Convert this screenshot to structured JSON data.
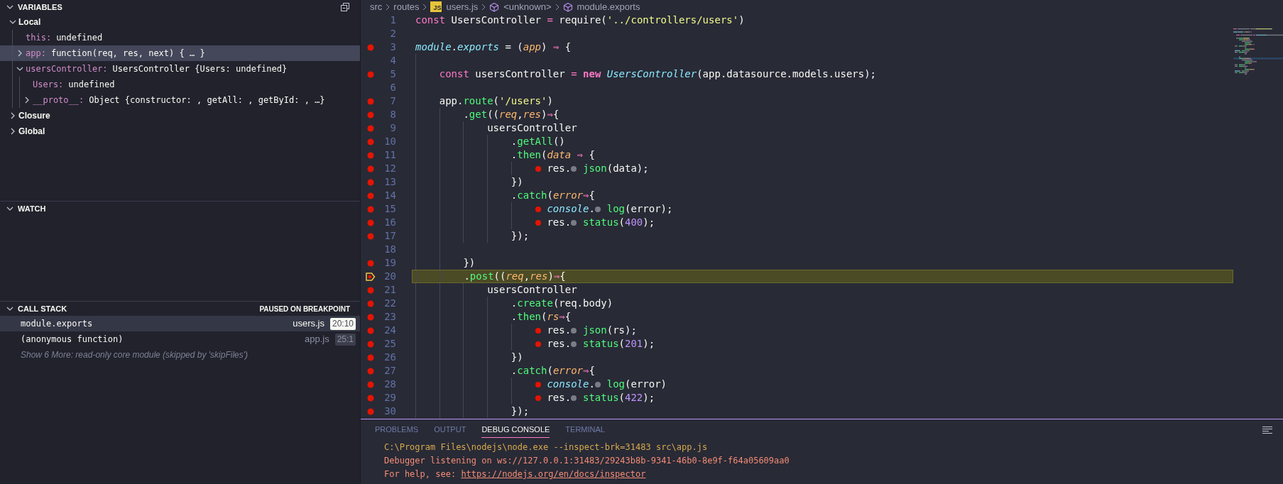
{
  "variables": {
    "title": "VARIABLES",
    "expanded": true,
    "items": [
      {
        "kind": "scope",
        "label": "Local",
        "expanded": true,
        "selected": false,
        "children": [
          {
            "kind": "variable",
            "name": "this:",
            "value": "undefined",
            "selected": false
          },
          {
            "kind": "variable",
            "name": "app:",
            "value": "function(req, res, next) { … }",
            "expanded": false,
            "selected": true
          },
          {
            "kind": "variable",
            "name": "usersController:",
            "value": "UsersController {Users: undefined}",
            "expanded": true,
            "selected": false,
            "children": [
              {
                "kind": "variable",
                "name": "Users:",
                "value": "undefined",
                "selected": false
              },
              {
                "kind": "variable",
                "name": "__proto__:",
                "value": "Object {constructor: , getAll: , getById: , …}",
                "expanded": false,
                "selected": false
              }
            ]
          }
        ]
      },
      {
        "kind": "scope",
        "label": "Closure",
        "expanded": false,
        "selected": false
      },
      {
        "kind": "scope",
        "label": "Global",
        "expanded": false,
        "selected": false
      }
    ]
  },
  "watch": {
    "title": "WATCH",
    "expanded": true
  },
  "call_stack": {
    "title": "CALL STACK",
    "expanded": true,
    "status": "PAUSED ON BREAKPOINT",
    "frames": [
      {
        "name": "module.exports",
        "file": "users.js",
        "position": "20:10",
        "selected": true
      },
      {
        "name": "(anonymous function)",
        "file": "app.js",
        "position": "25:1",
        "selected": false
      }
    ],
    "note": "Show 6 More: read-only core module (skipped by 'skipFiles')"
  },
  "breadcrumb": [
    {
      "kind": "folder",
      "label": "src"
    },
    {
      "kind": "folder",
      "label": "routes"
    },
    {
      "kind": "file",
      "label": "users.js",
      "icon_label": "JS"
    },
    {
      "kind": "symbol",
      "label": "<unknown>"
    },
    {
      "kind": "symbol",
      "label": "module.exports"
    }
  ],
  "lines": [
    {
      "number": "1",
      "breakpoint": false,
      "current": false,
      "tokens": [
        {
          "kind": "keyword",
          "text": "const"
        },
        {
          "kind": "plain",
          "text": " UsersController "
        },
        {
          "kind": "operator",
          "text": "="
        },
        {
          "kind": "plain",
          "text": " require("
        },
        {
          "kind": "string",
          "text": "'../controllers/users'"
        },
        {
          "kind": "plain",
          "text": ")"
        }
      ]
    },
    {
      "number": "2",
      "breakpoint": false,
      "current": false
    },
    {
      "number": "3",
      "breakpoint": true,
      "current": false,
      "tokens": [
        {
          "kind": "class",
          "text": "module"
        },
        {
          "kind": "plain",
          "text": "."
        },
        {
          "kind": "class",
          "text": "exports"
        },
        {
          "kind": "plain",
          "text": " = ("
        },
        {
          "kind": "param",
          "text": "app"
        },
        {
          "kind": "plain",
          "text": ") "
        },
        {
          "kind": "operator",
          "text": "⇒"
        },
        {
          "kind": "plain",
          "text": " {"
        }
      ]
    },
    {
      "number": "4",
      "breakpoint": false,
      "current": false
    },
    {
      "number": "5",
      "breakpoint": true,
      "current": false,
      "tokens": [
        {
          "kind": "keyword",
          "text": "    const"
        },
        {
          "kind": "plain",
          "text": " usersController "
        },
        {
          "kind": "operator",
          "text": "="
        },
        {
          "kind": "keyword_strong",
          "text": " new"
        },
        {
          "kind": "class",
          "text": " UsersController"
        },
        {
          "kind": "plain",
          "text": "(app.datasource.models.users);"
        }
      ]
    },
    {
      "number": "6",
      "breakpoint": false,
      "current": false
    },
    {
      "number": "7",
      "breakpoint": true,
      "current": false,
      "tokens": [
        {
          "kind": "plain",
          "text": "    app."
        },
        {
          "kind": "function",
          "text": "route"
        },
        {
          "kind": "plain",
          "text": "("
        },
        {
          "kind": "string",
          "text": "'/users'"
        },
        {
          "kind": "plain",
          "text": ")"
        }
      ]
    },
    {
      "number": "8",
      "breakpoint": true,
      "current": false,
      "tokens": [
        {
          "kind": "plain",
          "text": "        ."
        },
        {
          "kind": "function",
          "text": "get"
        },
        {
          "kind": "plain",
          "text": "(("
        },
        {
          "kind": "param",
          "text": "req"
        },
        {
          "kind": "plain",
          "text": ","
        },
        {
          "kind": "param",
          "text": "res"
        },
        {
          "kind": "plain",
          "text": ")"
        },
        {
          "kind": "operator",
          "text": "⇒"
        },
        {
          "kind": "plain",
          "text": "{"
        }
      ]
    },
    {
      "number": "9",
      "breakpoint": true,
      "current": false,
      "tokens": [
        {
          "kind": "plain",
          "text": "            usersController"
        }
      ]
    },
    {
      "number": "10",
      "breakpoint": true,
      "current": false,
      "tokens": [
        {
          "kind": "plain",
          "text": "                ."
        },
        {
          "kind": "function",
          "text": "getAll"
        },
        {
          "kind": "plain",
          "text": "()"
        }
      ]
    },
    {
      "number": "11",
      "breakpoint": true,
      "current": false,
      "tokens": [
        {
          "kind": "plain",
          "text": "                ."
        },
        {
          "kind": "function",
          "text": "then"
        },
        {
          "kind": "plain",
          "text": "("
        },
        {
          "kind": "param",
          "text": "data"
        },
        {
          "kind": "operator",
          "text": " ⇒"
        },
        {
          "kind": "plain",
          "text": " {"
        }
      ]
    },
    {
      "number": "12",
      "breakpoint": true,
      "current": false,
      "tokens": [
        {
          "kind": "inline_breakpoint"
        },
        {
          "kind": "plain",
          "text": " res."
        },
        {
          "kind": "breakpoint_hint"
        },
        {
          "kind": "function",
          "text": " json"
        },
        {
          "kind": "plain",
          "text": "(data);"
        }
      ]
    },
    {
      "number": "13",
      "breakpoint": true,
      "current": false,
      "tokens": [
        {
          "kind": "plain",
          "text": "                })"
        }
      ]
    },
    {
      "number": "14",
      "breakpoint": true,
      "current": false,
      "tokens": [
        {
          "kind": "plain",
          "text": "                ."
        },
        {
          "kind": "function",
          "text": "catch"
        },
        {
          "kind": "plain",
          "text": "("
        },
        {
          "kind": "param",
          "text": "error"
        },
        {
          "kind": "operator",
          "text": "⇒"
        },
        {
          "kind": "plain",
          "text": "{"
        }
      ]
    },
    {
      "number": "15",
      "breakpoint": true,
      "current": false,
      "tokens": [
        {
          "kind": "inline_breakpoint"
        },
        {
          "kind": "class",
          "text": " console"
        },
        {
          "kind": "plain",
          "text": "."
        },
        {
          "kind": "breakpoint_hint"
        },
        {
          "kind": "function",
          "text": " log"
        },
        {
          "kind": "plain",
          "text": "(error);"
        }
      ]
    },
    {
      "number": "16",
      "breakpoint": true,
      "current": false,
      "tokens": [
        {
          "kind": "inline_breakpoint"
        },
        {
          "kind": "plain",
          "text": " res."
        },
        {
          "kind": "breakpoint_hint"
        },
        {
          "kind": "function",
          "text": " status"
        },
        {
          "kind": "plain",
          "text": "("
        },
        {
          "kind": "number",
          "text": "400"
        },
        {
          "kind": "plain",
          "text": ");"
        }
      ]
    },
    {
      "number": "17",
      "breakpoint": true,
      "current": false,
      "tokens": [
        {
          "kind": "plain",
          "text": "                });"
        }
      ]
    },
    {
      "number": "18",
      "breakpoint": false,
      "current": false
    },
    {
      "number": "19",
      "breakpoint": true,
      "current": false,
      "tokens": [
        {
          "kind": "plain",
          "text": "        })"
        }
      ]
    },
    {
      "number": "20",
      "breakpoint": true,
      "current": true,
      "tokens": [
        {
          "kind": "plain",
          "text": "        ."
        },
        {
          "kind": "function",
          "text": "post"
        },
        {
          "kind": "plain",
          "text": "(("
        },
        {
          "kind": "param",
          "text": "req"
        },
        {
          "kind": "plain",
          "text": ","
        },
        {
          "kind": "param",
          "text": "res"
        },
        {
          "kind": "plain",
          "text": ")"
        },
        {
          "kind": "operator",
          "text": "⇒"
        },
        {
          "kind": "plain",
          "text": "{"
        }
      ]
    },
    {
      "number": "21",
      "breakpoint": true,
      "current": false,
      "tokens": [
        {
          "kind": "plain",
          "text": "            usersController"
        }
      ]
    },
    {
      "number": "22",
      "breakpoint": true,
      "current": false,
      "tokens": [
        {
          "kind": "plain",
          "text": "                ."
        },
        {
          "kind": "function",
          "text": "create"
        },
        {
          "kind": "plain",
          "text": "(req.body)"
        }
      ]
    },
    {
      "number": "23",
      "breakpoint": true,
      "current": false,
      "tokens": [
        {
          "kind": "plain",
          "text": "                ."
        },
        {
          "kind": "function",
          "text": "then"
        },
        {
          "kind": "plain",
          "text": "("
        },
        {
          "kind": "param",
          "text": "rs"
        },
        {
          "kind": "operator",
          "text": "⇒"
        },
        {
          "kind": "plain",
          "text": "{"
        }
      ]
    },
    {
      "number": "24",
      "breakpoint": true,
      "current": false,
      "tokens": [
        {
          "kind": "inline_breakpoint"
        },
        {
          "kind": "plain",
          "text": " res."
        },
        {
          "kind": "breakpoint_hint"
        },
        {
          "kind": "function",
          "text": " json"
        },
        {
          "kind": "plain",
          "text": "(rs);"
        }
      ]
    },
    {
      "number": "25",
      "breakpoint": true,
      "current": false,
      "tokens": [
        {
          "kind": "inline_breakpoint"
        },
        {
          "kind": "plain",
          "text": " res."
        },
        {
          "kind": "breakpoint_hint"
        },
        {
          "kind": "function",
          "text": " status"
        },
        {
          "kind": "plain",
          "text": "("
        },
        {
          "kind": "number",
          "text": "201"
        },
        {
          "kind": "plain",
          "text": ");"
        }
      ]
    },
    {
      "number": "26",
      "breakpoint": true,
      "current": false,
      "tokens": [
        {
          "kind": "plain",
          "text": "                })"
        }
      ]
    },
    {
      "number": "27",
      "breakpoint": true,
      "current": false,
      "tokens": [
        {
          "kind": "plain",
          "text": "                ."
        },
        {
          "kind": "function",
          "text": "catch"
        },
        {
          "kind": "plain",
          "text": "("
        },
        {
          "kind": "param",
          "text": "error"
        },
        {
          "kind": "operator",
          "text": "⇒"
        },
        {
          "kind": "plain",
          "text": "{"
        }
      ]
    },
    {
      "number": "28",
      "breakpoint": true,
      "current": false,
      "tokens": [
        {
          "kind": "inline_breakpoint"
        },
        {
          "kind": "class",
          "text": " console"
        },
        {
          "kind": "plain",
          "text": "."
        },
        {
          "kind": "breakpoint_hint"
        },
        {
          "kind": "function",
          "text": " log"
        },
        {
          "kind": "plain",
          "text": "(error)"
        }
      ]
    },
    {
      "number": "29",
      "breakpoint": true,
      "current": false,
      "tokens": [
        {
          "kind": "inline_breakpoint"
        },
        {
          "kind": "plain",
          "text": " res."
        },
        {
          "kind": "breakpoint_hint"
        },
        {
          "kind": "function",
          "text": " status"
        },
        {
          "kind": "plain",
          "text": "("
        },
        {
          "kind": "number",
          "text": "422"
        },
        {
          "kind": "plain",
          "text": ");"
        }
      ]
    },
    {
      "number": "30",
      "breakpoint": true,
      "current": false,
      "tokens": [
        {
          "kind": "plain",
          "text": "                });"
        }
      ]
    }
  ],
  "panel": {
    "tabs": [
      {
        "label": "PROBLEMS",
        "selected": false
      },
      {
        "label": "OUTPUT",
        "selected": false
      },
      {
        "label": "DEBUG CONSOLE",
        "selected": true
      },
      {
        "label": "TERMINAL",
        "selected": false
      }
    ],
    "console": [
      {
        "kind": "command",
        "text": "C:\\Program Files\\nodejs\\node.exe --inspect-brk=31483 src\\app.js"
      },
      {
        "kind": "info",
        "text": "Debugger listening on ws://127.0.0.1:31483/29243b8b-9341-46b0-8e9f-f64a05609aa0"
      },
      {
        "kind": "info",
        "text": "For help, see: ",
        "link": "https://nodejs.org/en/docs/inspector"
      }
    ]
  }
}
